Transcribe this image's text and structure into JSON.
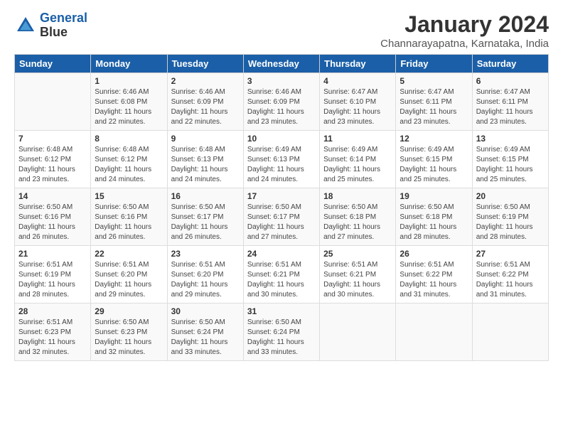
{
  "header": {
    "logo_line1": "General",
    "logo_line2": "Blue",
    "title": "January 2024",
    "subtitle": "Channarayapatna, Karnataka, India"
  },
  "days_of_week": [
    "Sunday",
    "Monday",
    "Tuesday",
    "Wednesday",
    "Thursday",
    "Friday",
    "Saturday"
  ],
  "weeks": [
    [
      {
        "day": "",
        "info": ""
      },
      {
        "day": "1",
        "info": "Sunrise: 6:46 AM\nSunset: 6:08 PM\nDaylight: 11 hours\nand 22 minutes."
      },
      {
        "day": "2",
        "info": "Sunrise: 6:46 AM\nSunset: 6:09 PM\nDaylight: 11 hours\nand 22 minutes."
      },
      {
        "day": "3",
        "info": "Sunrise: 6:46 AM\nSunset: 6:09 PM\nDaylight: 11 hours\nand 23 minutes."
      },
      {
        "day": "4",
        "info": "Sunrise: 6:47 AM\nSunset: 6:10 PM\nDaylight: 11 hours\nand 23 minutes."
      },
      {
        "day": "5",
        "info": "Sunrise: 6:47 AM\nSunset: 6:11 PM\nDaylight: 11 hours\nand 23 minutes."
      },
      {
        "day": "6",
        "info": "Sunrise: 6:47 AM\nSunset: 6:11 PM\nDaylight: 11 hours\nand 23 minutes."
      }
    ],
    [
      {
        "day": "7",
        "info": "Sunrise: 6:48 AM\nSunset: 6:12 PM\nDaylight: 11 hours\nand 23 minutes."
      },
      {
        "day": "8",
        "info": "Sunrise: 6:48 AM\nSunset: 6:12 PM\nDaylight: 11 hours\nand 24 minutes."
      },
      {
        "day": "9",
        "info": "Sunrise: 6:48 AM\nSunset: 6:13 PM\nDaylight: 11 hours\nand 24 minutes."
      },
      {
        "day": "10",
        "info": "Sunrise: 6:49 AM\nSunset: 6:13 PM\nDaylight: 11 hours\nand 24 minutes."
      },
      {
        "day": "11",
        "info": "Sunrise: 6:49 AM\nSunset: 6:14 PM\nDaylight: 11 hours\nand 25 minutes."
      },
      {
        "day": "12",
        "info": "Sunrise: 6:49 AM\nSunset: 6:15 PM\nDaylight: 11 hours\nand 25 minutes."
      },
      {
        "day": "13",
        "info": "Sunrise: 6:49 AM\nSunset: 6:15 PM\nDaylight: 11 hours\nand 25 minutes."
      }
    ],
    [
      {
        "day": "14",
        "info": "Sunrise: 6:50 AM\nSunset: 6:16 PM\nDaylight: 11 hours\nand 26 minutes."
      },
      {
        "day": "15",
        "info": "Sunrise: 6:50 AM\nSunset: 6:16 PM\nDaylight: 11 hours\nand 26 minutes."
      },
      {
        "day": "16",
        "info": "Sunrise: 6:50 AM\nSunset: 6:17 PM\nDaylight: 11 hours\nand 26 minutes."
      },
      {
        "day": "17",
        "info": "Sunrise: 6:50 AM\nSunset: 6:17 PM\nDaylight: 11 hours\nand 27 minutes."
      },
      {
        "day": "18",
        "info": "Sunrise: 6:50 AM\nSunset: 6:18 PM\nDaylight: 11 hours\nand 27 minutes."
      },
      {
        "day": "19",
        "info": "Sunrise: 6:50 AM\nSunset: 6:18 PM\nDaylight: 11 hours\nand 28 minutes."
      },
      {
        "day": "20",
        "info": "Sunrise: 6:50 AM\nSunset: 6:19 PM\nDaylight: 11 hours\nand 28 minutes."
      }
    ],
    [
      {
        "day": "21",
        "info": "Sunrise: 6:51 AM\nSunset: 6:19 PM\nDaylight: 11 hours\nand 28 minutes."
      },
      {
        "day": "22",
        "info": "Sunrise: 6:51 AM\nSunset: 6:20 PM\nDaylight: 11 hours\nand 29 minutes."
      },
      {
        "day": "23",
        "info": "Sunrise: 6:51 AM\nSunset: 6:20 PM\nDaylight: 11 hours\nand 29 minutes."
      },
      {
        "day": "24",
        "info": "Sunrise: 6:51 AM\nSunset: 6:21 PM\nDaylight: 11 hours\nand 30 minutes."
      },
      {
        "day": "25",
        "info": "Sunrise: 6:51 AM\nSunset: 6:21 PM\nDaylight: 11 hours\nand 30 minutes."
      },
      {
        "day": "26",
        "info": "Sunrise: 6:51 AM\nSunset: 6:22 PM\nDaylight: 11 hours\nand 31 minutes."
      },
      {
        "day": "27",
        "info": "Sunrise: 6:51 AM\nSunset: 6:22 PM\nDaylight: 11 hours\nand 31 minutes."
      }
    ],
    [
      {
        "day": "28",
        "info": "Sunrise: 6:51 AM\nSunset: 6:23 PM\nDaylight: 11 hours\nand 32 minutes."
      },
      {
        "day": "29",
        "info": "Sunrise: 6:50 AM\nSunset: 6:23 PM\nDaylight: 11 hours\nand 32 minutes."
      },
      {
        "day": "30",
        "info": "Sunrise: 6:50 AM\nSunset: 6:24 PM\nDaylight: 11 hours\nand 33 minutes."
      },
      {
        "day": "31",
        "info": "Sunrise: 6:50 AM\nSunset: 6:24 PM\nDaylight: 11 hours\nand 33 minutes."
      },
      {
        "day": "",
        "info": ""
      },
      {
        "day": "",
        "info": ""
      },
      {
        "day": "",
        "info": ""
      }
    ]
  ]
}
